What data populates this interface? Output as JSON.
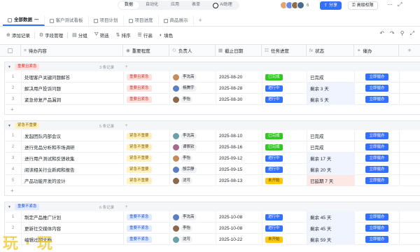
{
  "topbar": {
    "menu": [
      "数据",
      "自动化",
      "应用",
      "表单",
      "AI助理"
    ],
    "collaborator_count": "6",
    "share_label": "分享",
    "advanced_label": "高级权限"
  },
  "tabs": [
    "全部数据",
    "客户测试看板",
    "项目计划",
    "项目进度",
    "商品展示"
  ],
  "toolbar": {
    "add_record": "添加记录",
    "field_manage": "字段管理",
    "group": "分组",
    "filter": "筛选",
    "sort": "排序",
    "row_height": "行高",
    "fill_color": "填色"
  },
  "columns": [
    "待办内容",
    "重要程度",
    "负责人",
    "截止日期",
    "任务进度",
    "状态",
    "催办"
  ],
  "colors": {
    "accent": "#3370ff",
    "done": "#34c724",
    "not_started": "#ffc60a"
  },
  "groups": [
    {
      "label": "重要且紧急",
      "count": "3 条记录",
      "rows": [
        {
          "idx": "1",
          "task": "处理客户关键问题解答",
          "priority": "重要且紧急",
          "owner": "李沈高",
          "date": "2025-08-20",
          "progress": "已完成",
          "status": "已完成",
          "remind": "立即催办"
        },
        {
          "idx": "2",
          "task": "解决用户投诉问题",
          "priority": "重要且紧急",
          "owner": "杨腾宇",
          "date": "2025-08-28",
          "progress": "进行中",
          "status": "剩余 3 天",
          "remind": "立即催办"
        },
        {
          "idx": "3",
          "task": "紧急修复产品漏洞",
          "priority": "重要且紧急",
          "owner": "李怡",
          "date": "2025-08-30",
          "progress": "进行中",
          "status": "剩余 5 天",
          "remind": "立即催办"
        }
      ]
    },
    {
      "label": "紧急不重要",
      "count": "5 条记录",
      "rows": [
        {
          "idx": "1",
          "task": "发起团队内部会议",
          "priority": "紧急不重要",
          "owner": "李沈高",
          "date": "2025-08-10",
          "progress": "已完成",
          "status": "已完成",
          "remind": "立即催办"
        },
        {
          "idx": "2",
          "task": "进行竞品分析和市场调研",
          "priority": "紧急不重要",
          "owner": "谭佩钦",
          "date": "2025-08-16",
          "progress": "已完成",
          "status": "已完成",
          "remind": "立即催办"
        },
        {
          "idx": "3",
          "task": "进行用户测试和反馈收集",
          "priority": "紧急不重要",
          "owner": "李怡",
          "date": "2025-09-12",
          "progress": "进行中",
          "status": "剩余 17 天",
          "remind": "立即催办"
        },
        {
          "idx": "4",
          "task": "阅读相关行业新闻和报告",
          "priority": "紧急不重要",
          "owner": "殷宗静",
          "date": "2025-09-15",
          "progress": "进行中",
          "status": "剩余 20 天",
          "remind": "立即催办"
        },
        {
          "idx": "5",
          "task": "产品功能开发的设计",
          "priority": "紧急不重要",
          "owner": "沈可",
          "date": "2025-08-13",
          "progress": "未开始",
          "status": "已延期 7 天",
          "remind": "立即催办"
        }
      ]
    },
    {
      "label": "重要不紧急",
      "count": "6 条记录",
      "rows": [
        {
          "idx": "1",
          "task": "制定产品推广计划",
          "priority": "重要不紧急",
          "owner": "李沈高",
          "date": "2025-10-08",
          "progress": "进行中",
          "status": "剩余 45 天",
          "remind": "立即催办"
        },
        {
          "idx": "2",
          "task": "更新社交媒体内容",
          "priority": "重要不紧急",
          "owner": "李怡",
          "date": "2025-10-08",
          "progress": "进行中",
          "status": "剩余 45 天",
          "remind": "立即催办"
        },
        {
          "idx": "3",
          "task": "编辑过期文档",
          "priority": "重要不紧急",
          "owner": "沈可",
          "date": "2025-10-22",
          "progress": "未开始",
          "status": "剩余 59 天",
          "remind": "立即催办"
        }
      ]
    }
  ]
}
